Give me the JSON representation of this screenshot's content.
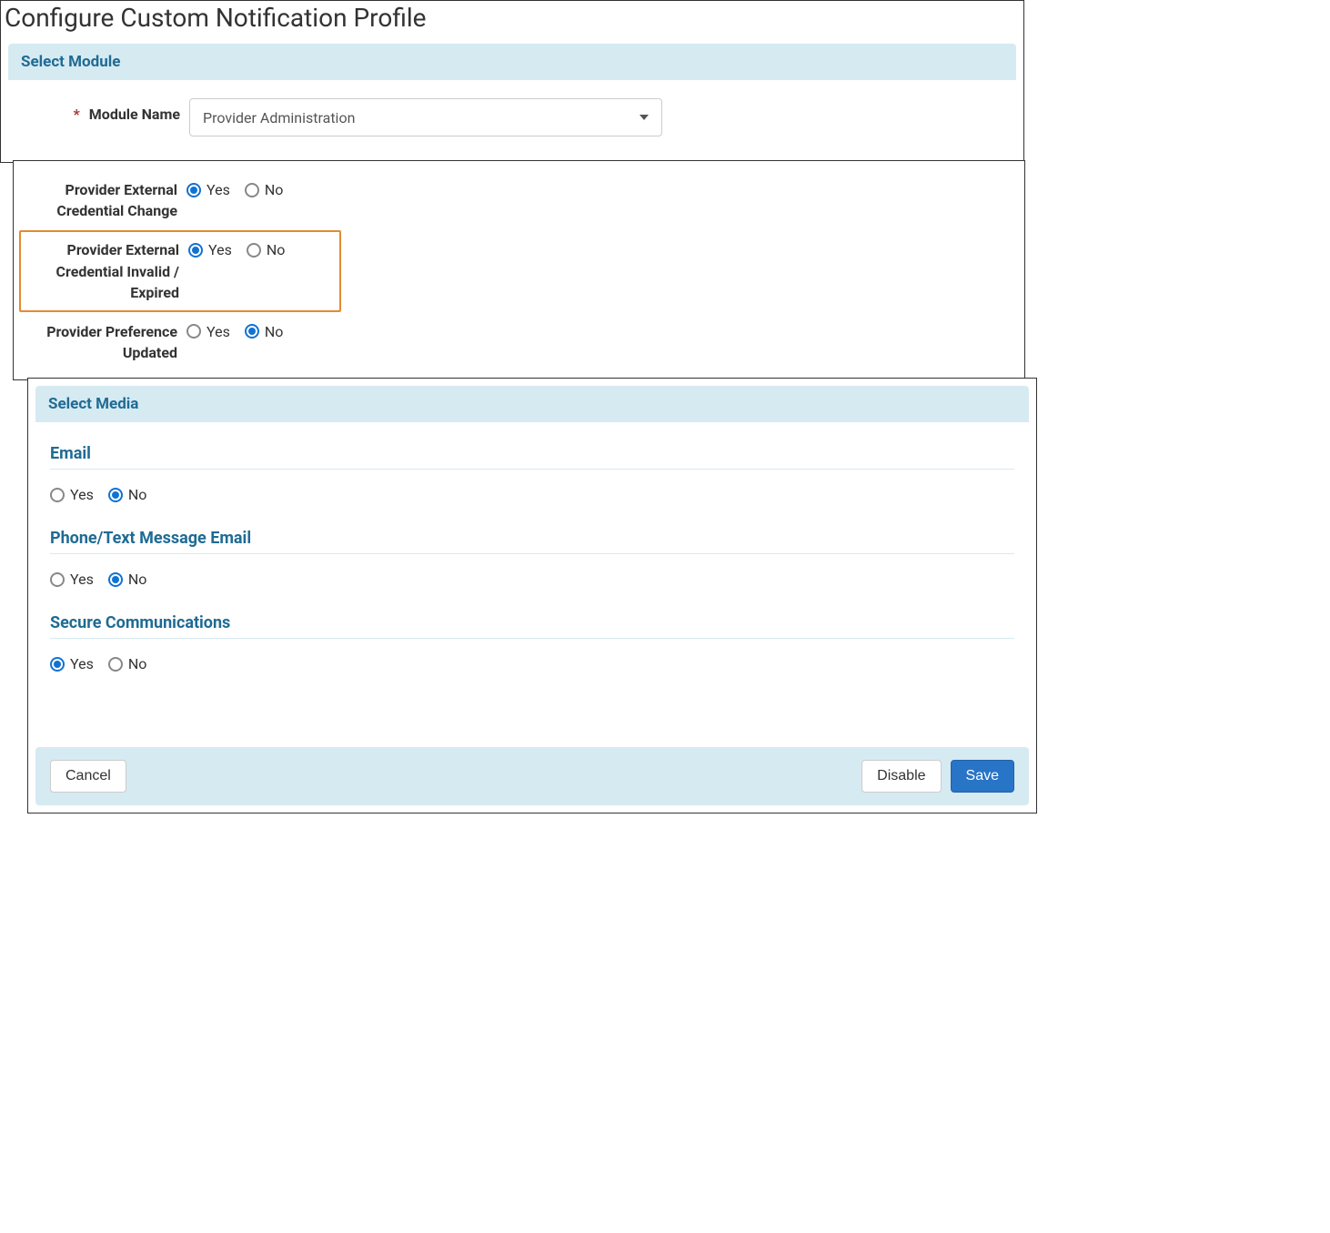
{
  "page_title": "Configure Custom Notification Profile",
  "select_module": {
    "header": "Select Module",
    "required_marker": "*",
    "label": "Module Name",
    "value": "Provider Administration"
  },
  "events": [
    {
      "label": "Provider External Credential Change",
      "yes": "Yes",
      "no": "No",
      "selected": "yes",
      "highlight": false
    },
    {
      "label": "Provider External Credential Invalid / Expired",
      "yes": "Yes",
      "no": "No",
      "selected": "yes",
      "highlight": true
    },
    {
      "label": "Provider Preference Updated",
      "yes": "Yes",
      "no": "No",
      "selected": "no",
      "highlight": false
    }
  ],
  "select_media": {
    "header": "Select Media",
    "sections": [
      {
        "title": "Email",
        "yes": "Yes",
        "no": "No",
        "selected": "no"
      },
      {
        "title": "Phone/Text Message Email",
        "yes": "Yes",
        "no": "No",
        "selected": "no"
      },
      {
        "title": "Secure Communications",
        "yes": "Yes",
        "no": "No",
        "selected": "yes"
      }
    ]
  },
  "footer": {
    "cancel": "Cancel",
    "disable": "Disable",
    "save": "Save"
  }
}
